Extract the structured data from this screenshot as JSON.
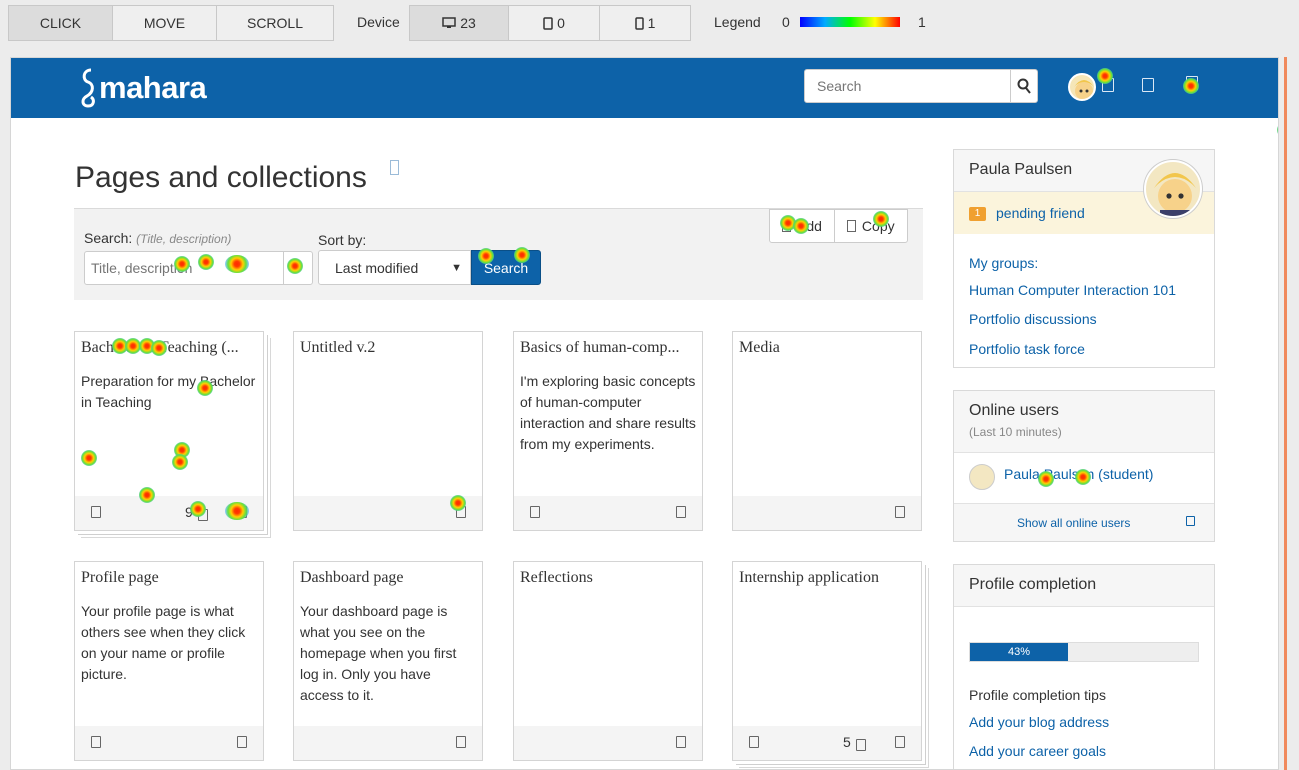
{
  "toolbar": {
    "modes": [
      "CLICK",
      "MOVE",
      "SCROLL"
    ],
    "device_label": "Device",
    "devices": [
      {
        "icon": "desktop-icon",
        "count": "23"
      },
      {
        "icon": "tablet-icon",
        "count": "0"
      },
      {
        "icon": "phone-icon",
        "count": "1"
      }
    ],
    "legend_label": "Legend",
    "legend_min": "0",
    "legend_max": "1",
    "legend_colors": [
      "#0000ff",
      "#00aaff",
      "#00ff00",
      "#ffff00",
      "#ff0000"
    ]
  },
  "header": {
    "logo_text": "mahara",
    "search_placeholder": "Search",
    "search_icon": "search-icon",
    "brand_color": "#0d62a8"
  },
  "main": {
    "title": "Pages and collections",
    "search_label": "Search:",
    "search_hint": "(Title, description)",
    "search_placeholder": "Title, description",
    "sort_label": "Sort by:",
    "sort_value": "Last modified",
    "search_button": "Search",
    "add_label": "Add",
    "copy_label": "Copy"
  },
  "cards": [
    {
      "title": "Bachelor in Teaching (...",
      "desc": "Preparation for my Bachelor in Teaching",
      "count": "9",
      "stack": true
    },
    {
      "title": "Untitled v.2",
      "desc": "",
      "count": "",
      "stack": false
    },
    {
      "title": "Basics of human-comp...",
      "desc": "I'm exploring basic concepts of human-computer interaction and share results from my experiments.",
      "count": "",
      "stack": false
    },
    {
      "title": "Media",
      "desc": "",
      "count": "",
      "stack": false
    },
    {
      "title": "Profile page",
      "desc": "Your profile page is what others see when they click on your name or profile picture.",
      "count": "",
      "stack": false
    },
    {
      "title": "Dashboard page",
      "desc": "Your dashboard page is what you see on the homepage when you first log in. Only you have access to it.",
      "count": "",
      "stack": false
    },
    {
      "title": "Reflections",
      "desc": "",
      "count": "",
      "stack": false
    },
    {
      "title": "Internship application",
      "desc": "",
      "count": "5",
      "stack": true
    }
  ],
  "sidebar": {
    "user_name": "Paula Paulsen",
    "pending_count": "1",
    "pending_label": "pending friend",
    "groups_label": "My groups:",
    "groups": [
      "Human Computer Interaction 101",
      "Portfolio discussions",
      "Portfolio task force"
    ],
    "online_title": "Online users",
    "online_sub": "(Last 10 minutes)",
    "online_user": "Paula Paulsen (student)",
    "show_all": "Show all online users",
    "completion_title": "Profile completion",
    "completion_percent": 43,
    "completion_text": "43%",
    "tips_label": "Profile completion tips",
    "tips": [
      "Add your blog address",
      "Add your career goals"
    ]
  }
}
